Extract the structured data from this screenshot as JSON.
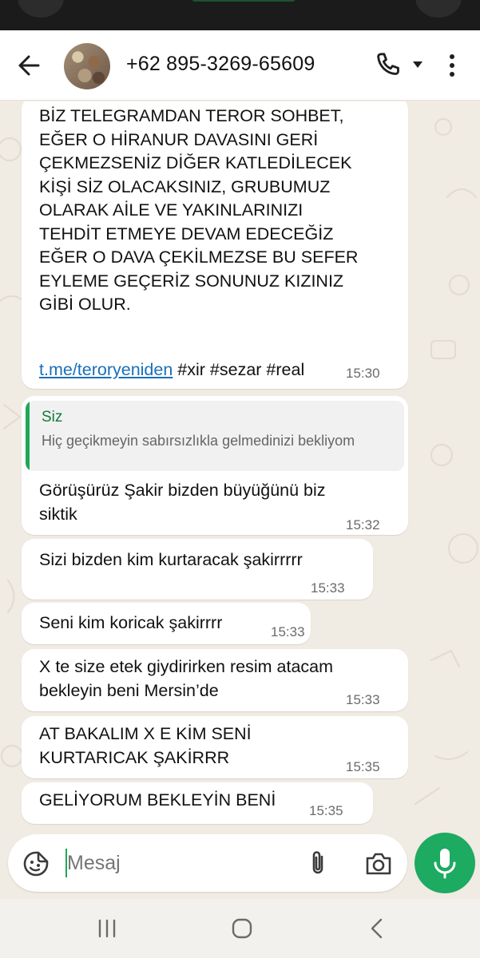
{
  "header": {
    "contact_name": "+62 895-3269-65609",
    "back_icon": "arrow-left-icon",
    "call_icon": "phone-icon",
    "caret_icon": "caret-down-icon",
    "menu_icon": "more-vertical-icon"
  },
  "messages": [
    {
      "text": "BİZ TELEGRAMDAN TEROR SOHBET,\nEĞER O HİRANUR DAVASINI GERİ\nÇEKMEZSENİZ DİĞER KATLEDİLECEK\nKİŞİ SİZ OLACAKSINIZ, GRUBUMUZ\nOLARAK AİLE VE YAKINLARINIZI\nTEHDİT ETMEYE DEVAM EDECEĞİZ\nEĞER O DAVA ÇEKİLMEZSE BU SEFER\nEYLEME GEÇERİZ SONUNUZ KIZINIZ\nGİBİ OLUR.",
      "link": "t.me/teroryeniden",
      "hashtags": " #xir #sezar #real",
      "time": "15:30"
    },
    {
      "quote_name": "Siz",
      "quote_text": "Hiç geçikmeyin sabırsızlıkla gelmedinizi bekliyom",
      "text": "Görüşürüz Şakir bizden büyüğünü biz\nsiktik",
      "time": "15:32"
    },
    {
      "text": "Sizi bizden kim kurtaracak şakirrrrr",
      "time": "15:33"
    },
    {
      "text": "Seni kim koricak şakirrrr",
      "time": "15:33"
    },
    {
      "text": "X te size etek giydirirken resim atacam\nbekleyin beni Mersin’de",
      "time": "15:33"
    },
    {
      "text": "AT BAKALIM X E KİM SENİ\nKURTARICAK ŞAKİRRR",
      "time": "15:35"
    },
    {
      "text": "GELİYORUM BEKLEYİN BENİ",
      "time": "15:35"
    }
  ],
  "composer": {
    "placeholder": "Mesaj",
    "emoji_icon": "sticker-emoji-icon",
    "attach_icon": "paperclip-icon",
    "camera_icon": "camera-icon",
    "mic_icon": "microphone-icon"
  },
  "navbar": {
    "recent_icon": "recent-apps-icon",
    "home_icon": "home-icon",
    "back_icon": "back-chevron-icon"
  },
  "colors": {
    "accent_green": "#1daa61",
    "link_blue": "#1a6fba",
    "chat_bg": "#f0ebe3",
    "bubble_bg": "#ffffff"
  }
}
